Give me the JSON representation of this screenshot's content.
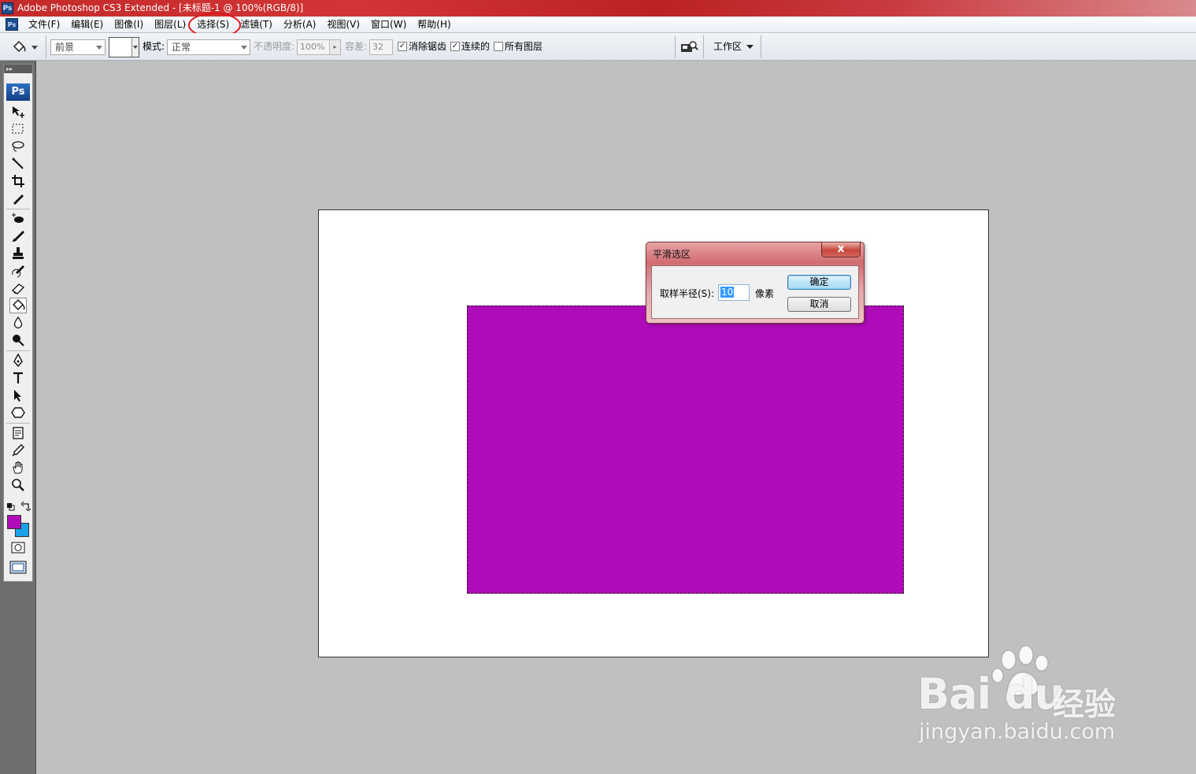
{
  "window": {
    "title": "Adobe Photoshop CS3 Extended - [未标题-1 @ 100%(RGB/8)]"
  },
  "menu": {
    "items": [
      {
        "label": "文件(F)"
      },
      {
        "label": "编辑(E)"
      },
      {
        "label": "图像(I)"
      },
      {
        "label": "图层(L)"
      },
      {
        "label": "选择(S)",
        "highlighted": true
      },
      {
        "label": "滤镜(T)"
      },
      {
        "label": "分析(A)"
      },
      {
        "label": "视图(V)"
      },
      {
        "label": "窗口(W)"
      },
      {
        "label": "帮助(H)"
      }
    ]
  },
  "options": {
    "fill_source": "前景",
    "mode_label": "模式:",
    "mode_value": "正常",
    "opacity_label": "不透明度:",
    "opacity_value": "100%",
    "tolerance_label": "容差:",
    "tolerance_value": "32",
    "antialias_label": "消除锯齿",
    "antialias_checked": true,
    "contiguous_label": "连续的",
    "contiguous_checked": true,
    "all_layers_label": "所有图层",
    "all_layers_checked": false,
    "workspace_label": "工作区"
  },
  "toolbox": {
    "logo": "Ps",
    "foreground_color": "#b00bb9",
    "background_color": "#1aa1ea",
    "active_tool": "paint-bucket-tool"
  },
  "document": {
    "selection_fill_color": "#b00bb9"
  },
  "dialog": {
    "title": "平滑选区",
    "close_label": "x",
    "radius_label": "取样半径(S):",
    "radius_value": "10",
    "unit": "像素",
    "ok_label": "确定",
    "cancel_label": "取消"
  },
  "watermark": {
    "brand": "Bai du",
    "brand_cn": "经验",
    "url": "jingyan.baidu.com"
  }
}
